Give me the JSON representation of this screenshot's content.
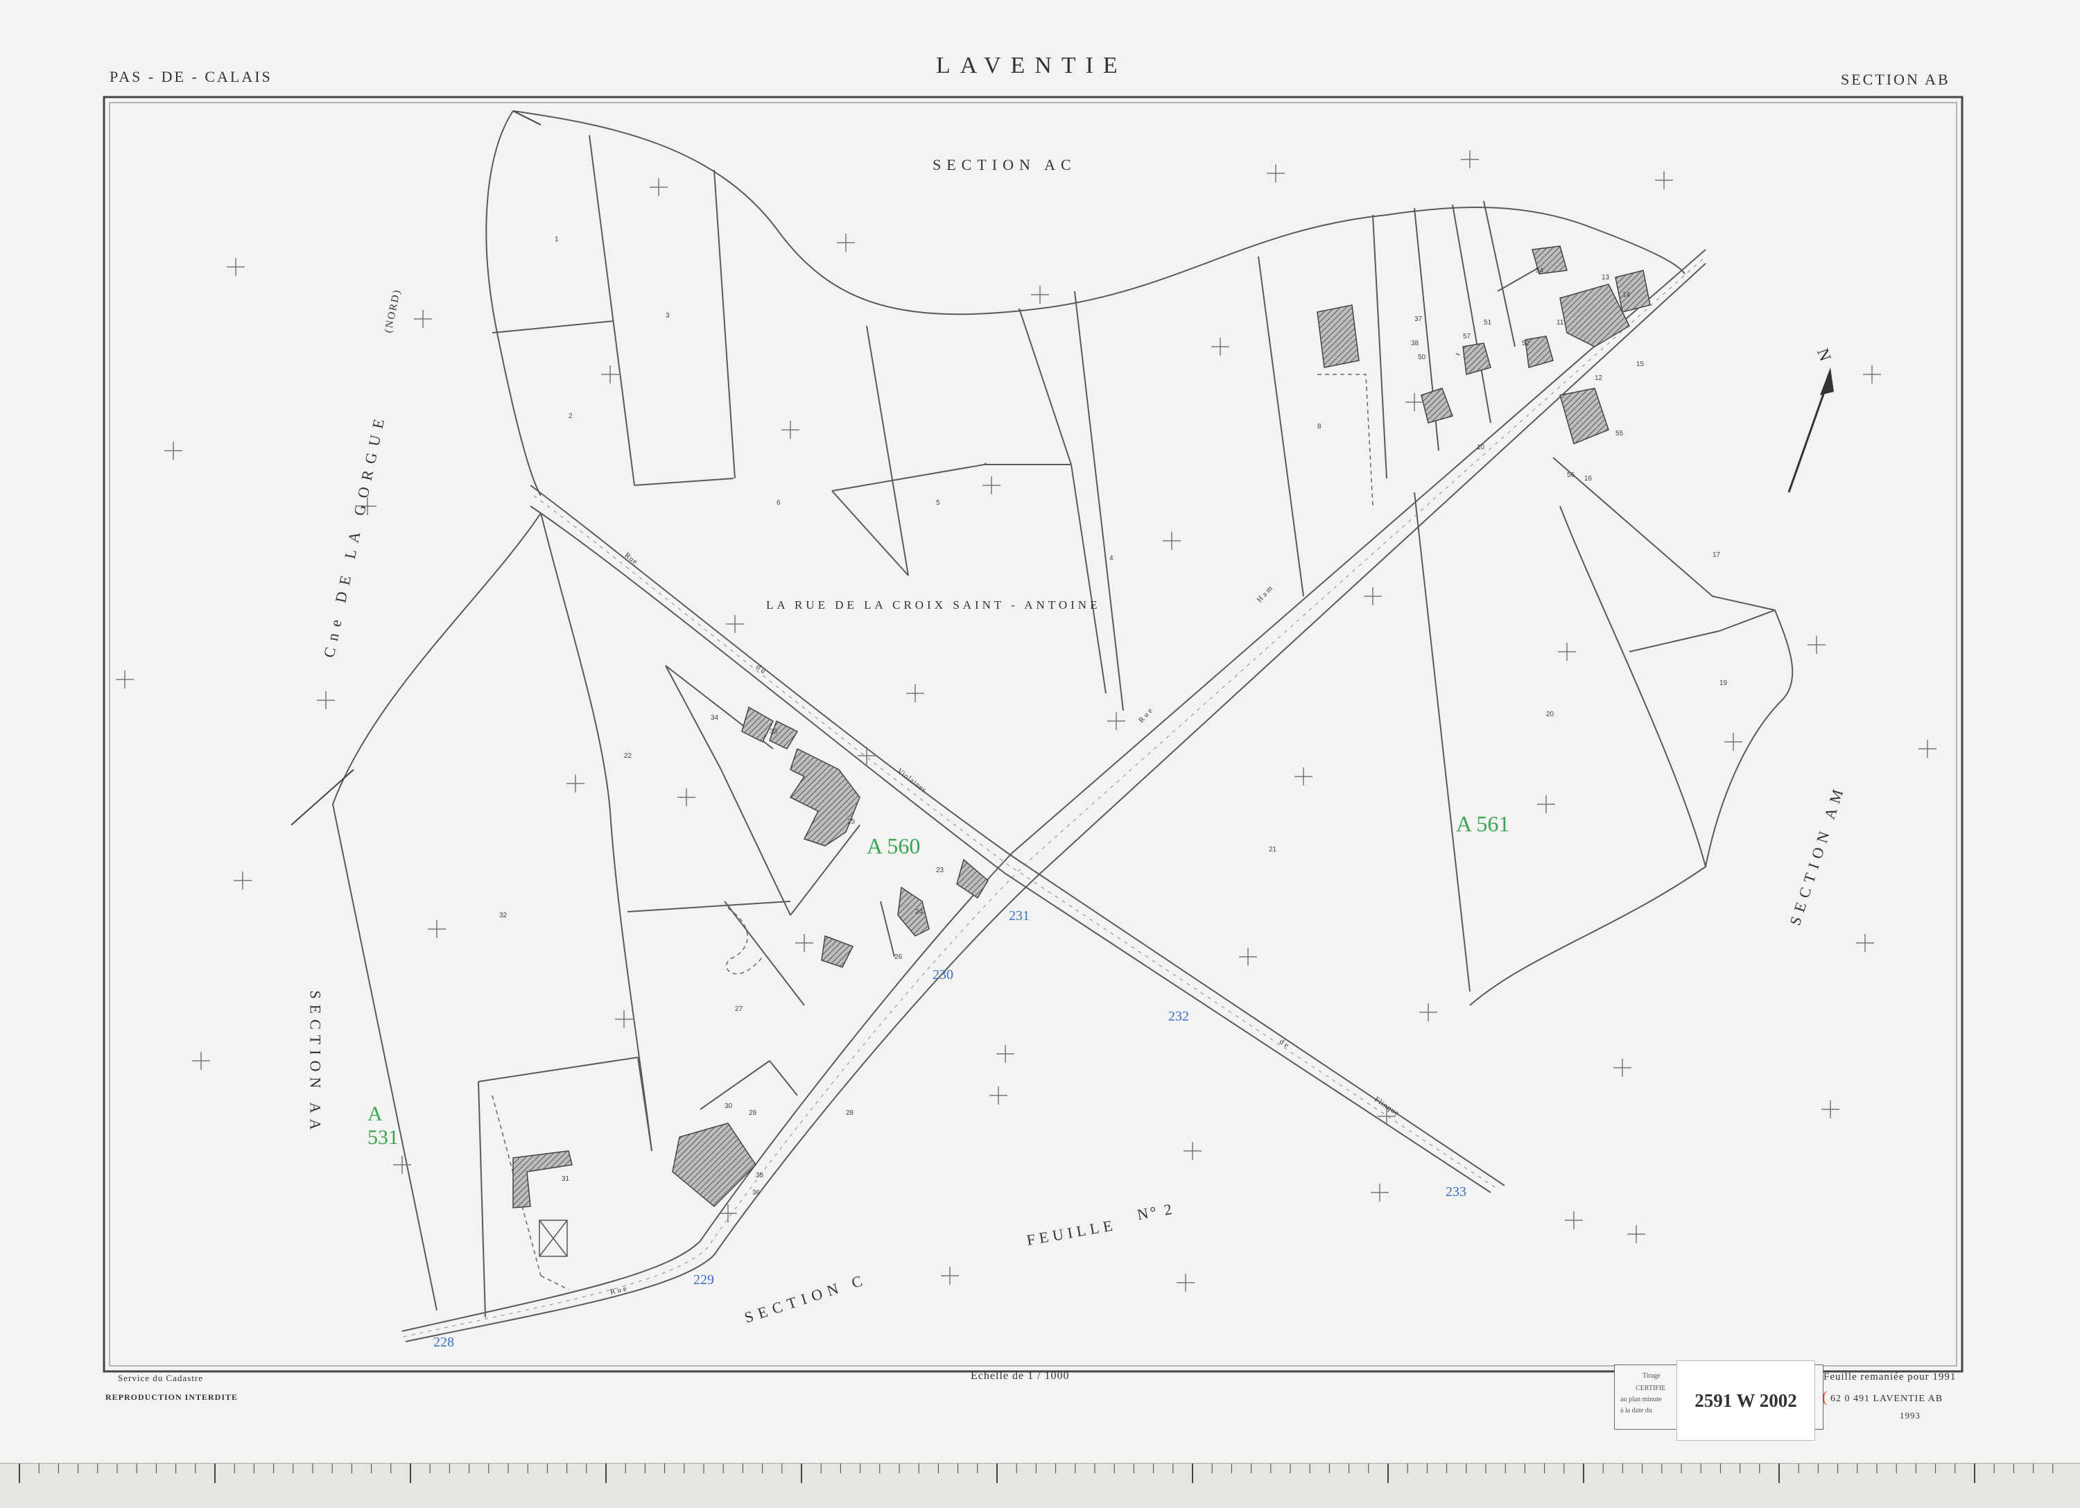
{
  "header": {
    "department": "PAS - DE - CALAIS",
    "commune": "LAVENTIE",
    "section": "SECTION  AB"
  },
  "map_labels": {
    "section_ac": "SECTION  AC",
    "section_am": "SECTION  AM",
    "section_aa": "SECTION  AA",
    "section_c": "SECTION  C",
    "feuille": "FEUILLE",
    "feuille_no": "N° 2",
    "chemin": "Cne  DE  LA  GORGUE",
    "nord": "(NORD)",
    "lieu_dit": "LA  RUE  DE  LA  CROIX  SAINT - ANTOINE",
    "north_arrow": "N"
  },
  "road_labels": {
    "rue_top": "Rue",
    "du": "du",
    "violaines": "Violaines",
    "ham": "Ham",
    "rue_low": "Rue",
    "rue_sw": "Rue",
    "de": "de",
    "flinque": "Flinque"
  },
  "parcel_numbers": [
    "1",
    "2",
    "3",
    "4",
    "5",
    "6",
    "8",
    "10",
    "11",
    "12",
    "13",
    "14",
    "15",
    "16",
    "17",
    "19",
    "20",
    "21",
    "22",
    "23",
    "24",
    "25",
    "26",
    "27",
    "28",
    "29",
    "30",
    "31",
    "32",
    "33",
    "34",
    "35",
    "36",
    "37",
    "38",
    "50",
    "51",
    "52",
    "54",
    "55",
    "56",
    "57"
  ],
  "annotations": {
    "green_a560": "A 560",
    "green_a561": "A 561",
    "green_a531": "A 531",
    "blue_231": "231",
    "blue_230": "230",
    "blue_232": "232",
    "blue_233": "233",
    "blue_229": "229",
    "blue_228": "228"
  },
  "footer": {
    "service": "Service du Cadastre",
    "reproduction": "REPRODUCTION  INTERDITE",
    "scale": "Echelle de 1 / 1000",
    "feuille_remaniee": "Feuille remaniée pour 1991",
    "ref": "62 0 491  LAVENTIE  AB",
    "year": "1993",
    "tirage": "Tirage",
    "certifie": "CERTIFIE",
    "minute": "au plan minute",
    "date": "à la date du",
    "archive": "2591 W 2002"
  },
  "colors": {
    "line": "#5a5a5a",
    "building": "#8a8a8a",
    "green_ink": "#3aa655",
    "blue_ink": "#3c6fc2",
    "red_ink": "#d33a2c",
    "paper": "#f3f3f1"
  }
}
